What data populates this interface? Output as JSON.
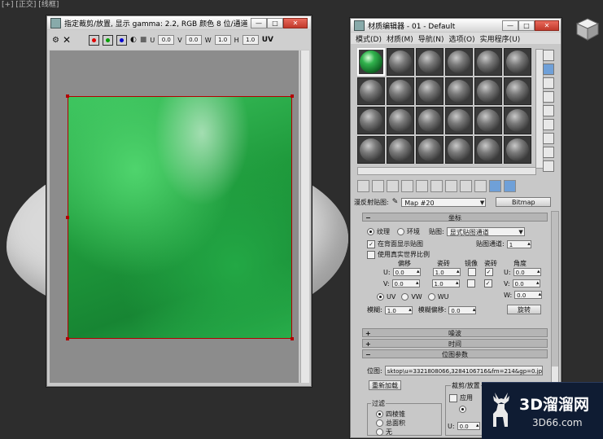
{
  "viewport": {
    "label": "[+] [正交] [线框]",
    "object_color": "#d9d9d9",
    "background": "#2d2d2d"
  },
  "crop_window": {
    "title": "指定裁剪/放置, 显示 gamma: 2.2, RGB 颜色 8 位/通道 (1:2)",
    "toolbar": {
      "channel_colors": [
        "#e00000",
        "#00a000",
        "#0000d0"
      ],
      "u_label": "U",
      "u_value": "0.0",
      "v_label": "V",
      "v_value": "0.0",
      "w_label": "W",
      "w_value": "1.0",
      "h_label": "H",
      "h_value": "1.0",
      "uv_label": "UV"
    },
    "crop_border_color": "#b30000"
  },
  "material_editor": {
    "title": "材质编辑器 - 01 - Default",
    "menu": [
      "模式(D)",
      "材质(M)",
      "导航(N)",
      "选项(O)",
      "实用程序(U)"
    ],
    "slot_count": 24,
    "selected_slot": 0,
    "map_row": {
      "label": "漫反射贴图:",
      "map_name": "Map #20",
      "map_type": "Bitmap"
    },
    "coords": {
      "rollout_title": "坐标",
      "radio_texture": "纹理",
      "radio_env": "环境",
      "mapping_label": "贴图:",
      "mapping_value": "显式贴图通道",
      "show_on_back": "在背面显示贴图",
      "map_channel_label": "贴图通道:",
      "map_channel_value": "1",
      "real_world": "使用真实世界比例",
      "col_offset": "偏移",
      "col_tiling": "瓷砖",
      "col_mirror": "镜像",
      "col_tile": "瓷砖",
      "col_angle": "角度",
      "u_label": "U:",
      "u_offset": "0.0",
      "u_tiling": "1.0",
      "u_angle": "0.0",
      "v_label": "V:",
      "v_offset": "0.0",
      "v_tiling": "1.0",
      "v_angle": "0.0",
      "w_label": "W:",
      "w_angle": "0.0",
      "uv": "UV",
      "vw": "VW",
      "wu": "WU",
      "blur_label": "模糊:",
      "blur_value": "1.0",
      "blur_offset_label": "模糊偏移:",
      "blur_offset_value": "0.0",
      "rotate_button": "旋转"
    },
    "noise_title": "噪波",
    "time_title": "时间",
    "bitmap_params": {
      "rollout_title": "位图参数",
      "bitmap_label": "位图:",
      "bitmap_path": "sktop\\u=3321808066,3284106716&fm=214&gp=0.jpg",
      "reload_button": "重新加载",
      "crop_group": "裁剪/放置",
      "apply_label": "应用",
      "filter_group": "过滤",
      "filter_options": [
        "四棱锥",
        "总面积",
        "无"
      ],
      "u_small_label": "U:",
      "u_small_value": "0.0"
    }
  },
  "watermark": {
    "brand": "3D溜溜网",
    "domain": "3D66.com"
  }
}
